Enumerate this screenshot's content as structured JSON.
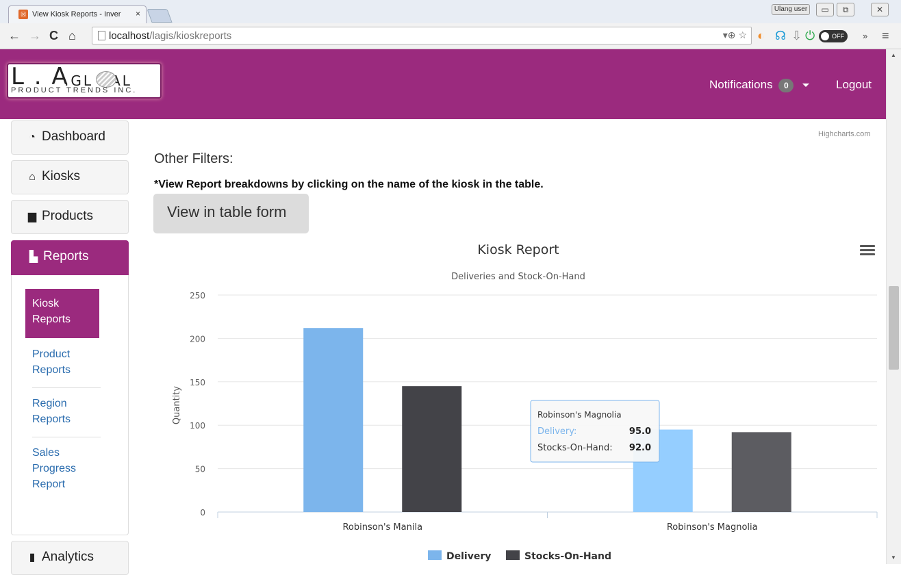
{
  "browser": {
    "tab_title": "View Kiosk Reports - Inver",
    "tab_close": "×",
    "user_badge": "Ulang user",
    "url_host": "localhost",
    "url_path": "/lagis/kioskreports",
    "toggle_label": "OFF"
  },
  "header": {
    "logo_letters": "L . A",
    "logo_global": ".GL  BAL",
    "logo_tagline": "PRODUCT TRENDS INC.",
    "notifications_label": "Notifications",
    "notifications_count": "0",
    "logout_label": "Logout"
  },
  "sidebar": {
    "dashboard": "Dashboard",
    "kiosks": "Kiosks",
    "products": "Products",
    "reports": "Reports",
    "analytics": "Analytics",
    "sub_items": {
      "kiosk_reports": "Kiosk Reports",
      "product_reports": "Product Reports",
      "region_reports": "Region Reports",
      "sales_progress": "Sales Progress Report"
    }
  },
  "main": {
    "credit": "Highcharts.com",
    "filters_title": "Other Filters:",
    "hint": "*View Report breakdowns by clicking on the name of the kiosk in the table.",
    "table_button": "View in table form"
  },
  "chart_data": {
    "type": "bar",
    "title": "Kiosk Report",
    "subtitle": "Deliveries and Stock-On-Hand",
    "ylabel": "Quantity",
    "xlabel": "",
    "ylim": [
      0,
      250
    ],
    "yticks": [
      0,
      50,
      100,
      150,
      200,
      250
    ],
    "categories": [
      "Robinson's Manila",
      "Robinson's Magnolia"
    ],
    "series": [
      {
        "name": "Delivery",
        "color": "#7cb5ec",
        "values": [
          212,
          95
        ]
      },
      {
        "name": "Stocks-On-Hand",
        "color": "#434348",
        "values": [
          145,
          92
        ]
      }
    ],
    "legend": "bottom-center",
    "tooltip": {
      "category": "Robinson's Magnolia",
      "lines": [
        {
          "label": "Delivery:",
          "value": "95.0"
        },
        {
          "label": "Stocks-On-Hand:",
          "value": "92.0"
        }
      ]
    }
  }
}
